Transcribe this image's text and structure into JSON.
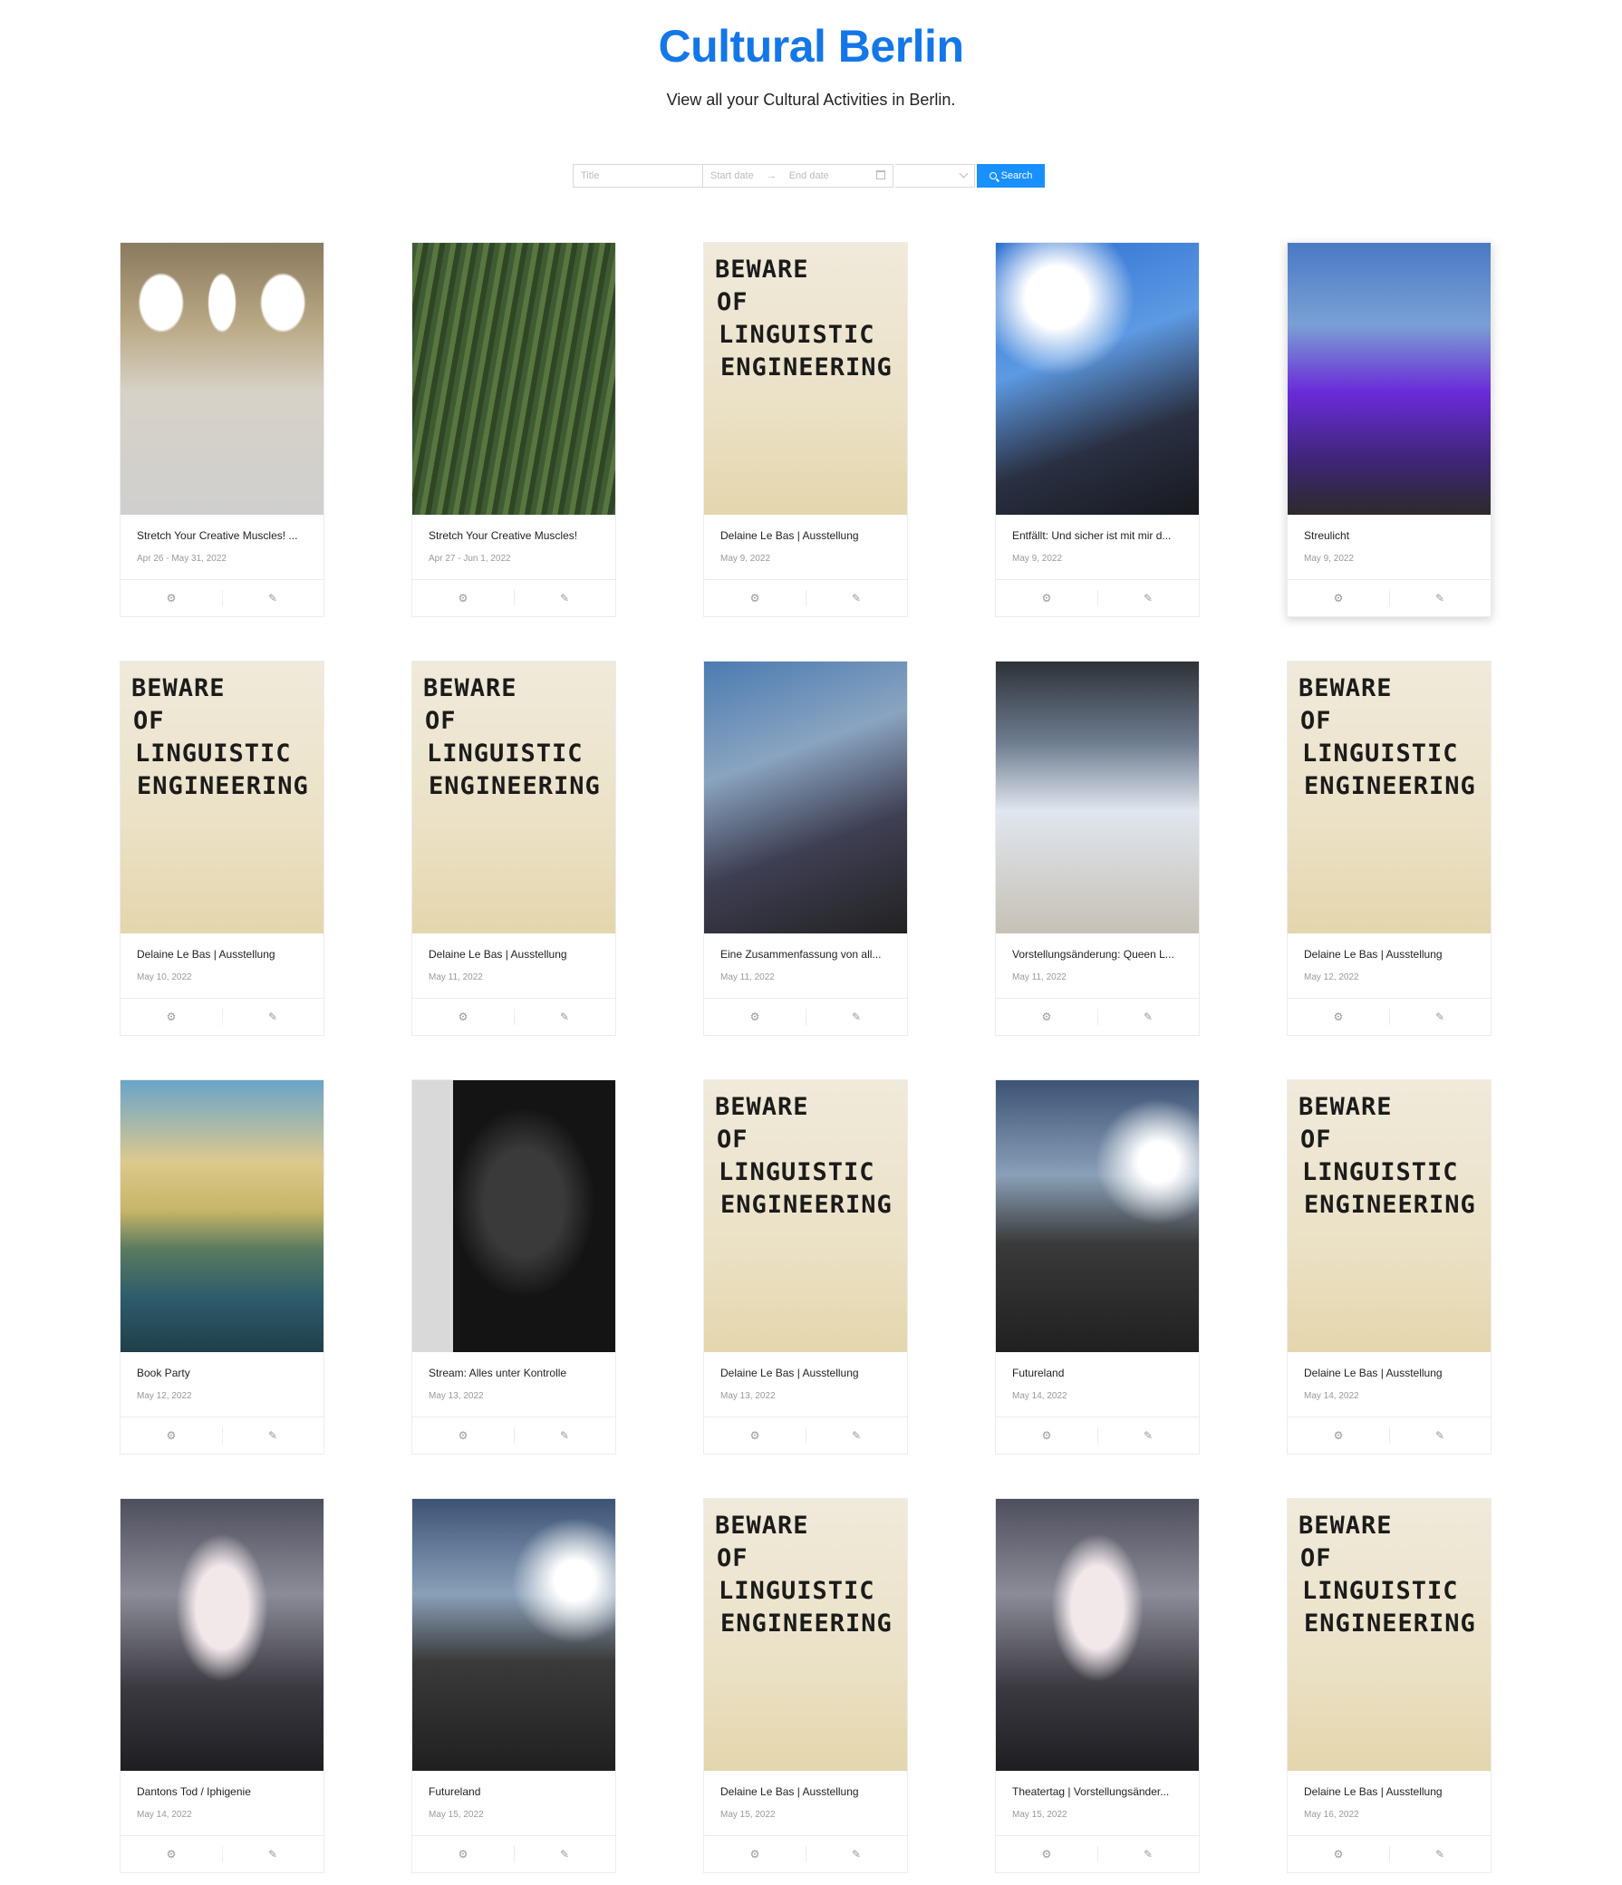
{
  "header": {
    "title": "Cultural Berlin",
    "subtitle": "View all your Cultural Activities in Berlin."
  },
  "search": {
    "title_placeholder": "Title",
    "start_placeholder": "Start date",
    "end_placeholder": "End date",
    "arrow": "→",
    "button_label": "Search"
  },
  "poster": {
    "line1": "BEWARE",
    "line2": "OF",
    "line3": "LINGUISTIC",
    "line4": "ENGINEERING"
  },
  "icons": {
    "settings": "settings-gear-icon",
    "edit": "edit-pencil-icon"
  },
  "events": [
    {
      "title": "Stretch Your Creative Muscles! ...",
      "date": "Apr 26 - May 31, 2022",
      "image": "station"
    },
    {
      "title": "Stretch Your Creative Muscles!",
      "date": "Apr 27 - Jun 1, 2022",
      "image": "field"
    },
    {
      "title": "Delaine Le Bas | Ausstellung",
      "date": "May 9, 2022",
      "image": "poster"
    },
    {
      "title": "Entfällt: Und sicher ist mit mir d...",
      "date": "May 9, 2022",
      "image": "blue"
    },
    {
      "title": "Streulicht",
      "date": "May 9, 2022",
      "image": "purple"
    },
    {
      "title": "Delaine Le Bas | Ausstellung",
      "date": "May 10, 2022",
      "image": "poster"
    },
    {
      "title": "Delaine Le Bas | Ausstellung",
      "date": "May 11, 2022",
      "image": "poster"
    },
    {
      "title": "Eine Zusammenfassung von all...",
      "date": "May 11, 2022",
      "image": "smoke"
    },
    {
      "title": "Vorstellungsänderung: Queen L...",
      "date": "May 11, 2022",
      "image": "ice"
    },
    {
      "title": "Delaine Le Bas | Ausstellung",
      "date": "May 12, 2022",
      "image": "poster"
    },
    {
      "title": "Book Party",
      "date": "May 12, 2022",
      "image": "canal"
    },
    {
      "title": "Stream: Alles unter Kontrolle",
      "date": "May 13, 2022",
      "image": "dark"
    },
    {
      "title": "Delaine Le Bas | Ausstellung",
      "date": "May 13, 2022",
      "image": "poster"
    },
    {
      "title": "Futureland",
      "date": "May 14, 2022",
      "image": "future"
    },
    {
      "title": "Delaine Le Bas | Ausstellung",
      "date": "May 14, 2022",
      "image": "poster"
    },
    {
      "title": "Dantons Tod / Iphigenie",
      "date": "May 14, 2022",
      "image": "pale"
    },
    {
      "title": "Futureland",
      "date": "May 15, 2022",
      "image": "future"
    },
    {
      "title": "Delaine Le Bas | Ausstellung",
      "date": "May 15, 2022",
      "image": "poster"
    },
    {
      "title": "Theatertag | Vorstellungsänder...",
      "date": "May 15, 2022",
      "image": "pale"
    },
    {
      "title": "Delaine Le Bas | Ausstellung",
      "date": "May 16, 2022",
      "image": "poster"
    }
  ]
}
